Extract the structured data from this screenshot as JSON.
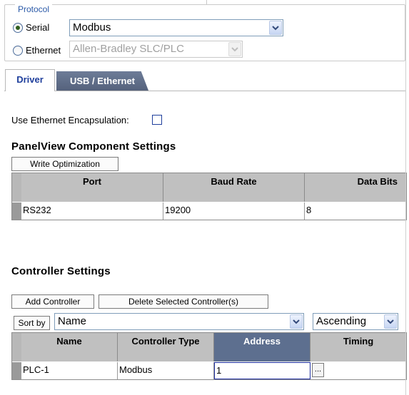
{
  "protocol": {
    "legend": "Protocol",
    "serial_label": "Serial",
    "serial_value": "Modbus",
    "ethernet_label": "Ethernet",
    "ethernet_value": "Allen-Bradley SLC/PLC",
    "selected": "Serial"
  },
  "tabs": [
    {
      "label": "Driver",
      "active": true
    },
    {
      "label": "USB / Ethernet",
      "active": false
    }
  ],
  "driver": {
    "encapsulation_label": "Use Ethernet Encapsulation:",
    "encapsulation_checked": false
  },
  "panelview": {
    "title": "PanelView Component Settings",
    "write_optimization_label": "Write Optimization",
    "columns": [
      "Port",
      "Baud Rate",
      "Data Bits"
    ],
    "rows": [
      [
        "RS232",
        "19200",
        "8"
      ]
    ]
  },
  "controller": {
    "title": "Controller Settings",
    "add_label": "Add Controller",
    "delete_label": "Delete Selected Controller(s)",
    "sort_by_label": "Sort by",
    "sort_field": "Name",
    "sort_order": "Ascending",
    "columns": [
      "Name",
      "Controller Type",
      "Address",
      "Timing"
    ],
    "selected_column": "Address",
    "rows": [
      [
        "PLC-1",
        "Modbus",
        "1",
        ""
      ]
    ],
    "timing_button": "..."
  },
  "icons": {
    "dropdown": "chevron-down-icon",
    "radio": "radio-icon",
    "checkbox": "checkbox-icon"
  },
  "colors": {
    "legend": "#2b5aa8",
    "tab_active_text": "#1f3f9c",
    "tab_inactive_bg": "#5d6b87",
    "header_bg": "#c0c0c0",
    "header_selected_bg": "#5d6f8f"
  }
}
